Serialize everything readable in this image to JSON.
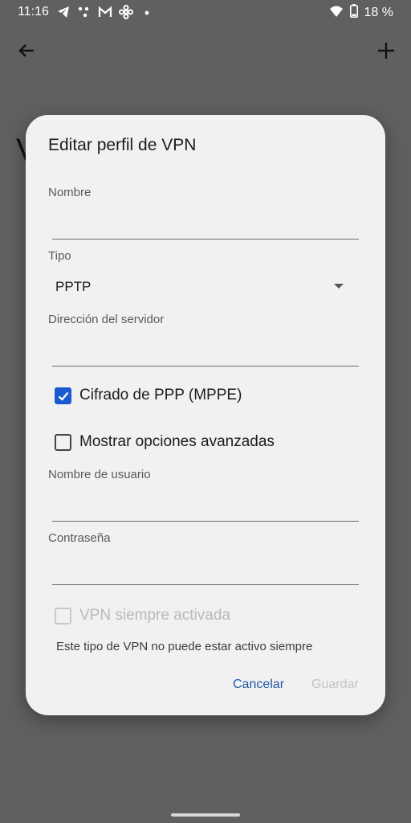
{
  "status_bar": {
    "time": "11:16",
    "battery": "18 %",
    "icons": [
      "telegram-icon",
      "dots-icon",
      "gmail-icon",
      "pinwheel-icon",
      "dot-icon",
      "wifi-icon",
      "battery-icon"
    ]
  },
  "app_bar": {
    "background_letter": "V"
  },
  "dialog": {
    "title": "Editar perfil de VPN",
    "name_label": "Nombre",
    "name_value": "",
    "type_label": "Tipo",
    "type_value": "PPTP",
    "server_label": "Dirección del servidor",
    "server_value": "",
    "mppe_label": "Cifrado de PPP (MPPE)",
    "mppe_checked": true,
    "advanced_label": "Mostrar opciones avanzadas",
    "advanced_checked": false,
    "username_label": "Nombre de usuario",
    "username_value": "",
    "password_label": "Contraseña",
    "password_value": "",
    "always_on_label": "VPN siempre activada",
    "always_on_checked": false,
    "always_on_note": "Este tipo de VPN no puede estar activo siempre",
    "cancel_label": "Cancelar",
    "save_label": "Guardar"
  },
  "colors": {
    "scrim": "#606060",
    "dialog_bg": "#f1f1f1",
    "accent": "#1a5ad1",
    "button_text": "#2458a8",
    "disabled_text": "#c4c4c4"
  }
}
